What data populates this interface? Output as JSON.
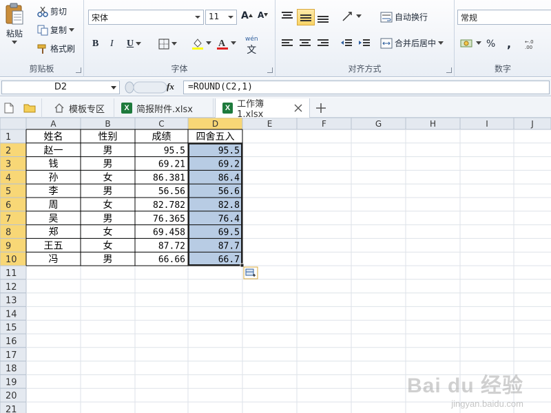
{
  "ribbon": {
    "clipboard": {
      "label": "剪贴板",
      "paste": "粘贴",
      "cut": "剪切",
      "copy": "复制",
      "format_painter": "格式刷"
    },
    "font": {
      "label": "字体",
      "font_name": "宋体",
      "font_size": "11",
      "bold": "B",
      "italic": "I",
      "underline": "U",
      "phonetic": "wén"
    },
    "alignment": {
      "label": "对齐方式",
      "wrap_text": "自动换行",
      "merge_center": "合并后居中"
    },
    "number": {
      "label": "数字",
      "format": "常规",
      "percent": "%",
      "comma": ","
    }
  },
  "formula_bar": {
    "name_box": "D2",
    "fx": "fx",
    "formula": "=ROUND(C2,1)"
  },
  "tabs": [
    {
      "label": "模板专区",
      "icon": "home-icon"
    },
    {
      "label": "简报附件.xlsx",
      "icon": "excel-file-icon"
    },
    {
      "label": "工作簿1.xlsx",
      "icon": "excel-file-icon",
      "active": true
    }
  ],
  "sheet": {
    "columns": [
      "A",
      "B",
      "C",
      "D",
      "E",
      "F",
      "G",
      "H",
      "I",
      "J"
    ],
    "row_count": 21,
    "header_row": [
      "姓名",
      "性别",
      "成绩",
      "四舍五入"
    ],
    "rows": [
      [
        "赵一",
        "男",
        "95.5",
        "95.5"
      ],
      [
        "钱",
        "男",
        "69.21",
        "69.2"
      ],
      [
        "孙",
        "女",
        "86.381",
        "86.4"
      ],
      [
        "李",
        "男",
        "56.56",
        "56.6"
      ],
      [
        "周",
        "女",
        "82.782",
        "82.8"
      ],
      [
        "吴",
        "男",
        "76.365",
        "76.4"
      ],
      [
        "郑",
        "女",
        "69.458",
        "69.5"
      ],
      [
        "王五",
        "女",
        "87.72",
        "87.7"
      ],
      [
        "冯",
        "男",
        "66.66",
        "66.7"
      ]
    ],
    "active_column": "D",
    "selected_range": "D2:D10"
  },
  "colors": {
    "accent_selection": "#b8cce4",
    "header_active": "#f8d776",
    "excel_green": "#1e7a3c"
  },
  "watermark": {
    "brand": "Bai du 经验",
    "url": "jingyan.baidu.com"
  }
}
